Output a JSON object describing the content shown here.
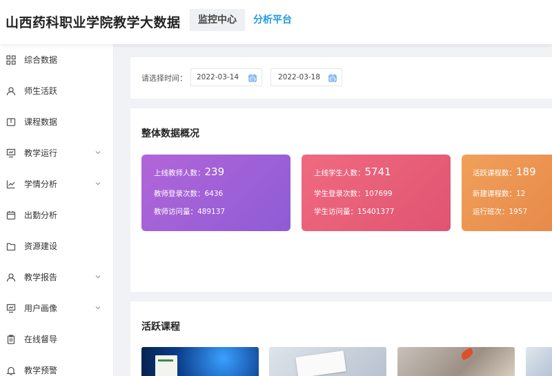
{
  "header": {
    "title": "山西药科职业学院教学大数据",
    "tabs": [
      {
        "label": "监控中心",
        "active": false
      },
      {
        "label": "分析平台",
        "active": true
      }
    ],
    "accent_color": "#1e9be0"
  },
  "sidebar": {
    "items": [
      {
        "label": "综合数据",
        "icon": "grid-icon",
        "expandable": false
      },
      {
        "label": "师生活跃",
        "icon": "user-icon",
        "expandable": false
      },
      {
        "label": "课程数据",
        "icon": "book-icon",
        "expandable": false
      },
      {
        "label": "教学运行",
        "icon": "monitor-icon",
        "expandable": true
      },
      {
        "label": "学情分析",
        "icon": "line-chart-icon",
        "expandable": true
      },
      {
        "label": "出勤分析",
        "icon": "calendar-icon",
        "expandable": false
      },
      {
        "label": "资源建设",
        "icon": "folder-icon",
        "expandable": false
      },
      {
        "label": "教学报告",
        "icon": "user-icon",
        "expandable": true
      },
      {
        "label": "用户画像",
        "icon": "monitor-icon",
        "expandable": true
      },
      {
        "label": "在线督导",
        "icon": "clipboard-icon",
        "expandable": false
      },
      {
        "label": "教学预警",
        "icon": "bell-icon",
        "expandable": false
      }
    ]
  },
  "date_filter": {
    "label": "请选择时间：",
    "start": "2022-03-14",
    "end": "2022-03-18",
    "separator": "-"
  },
  "overview": {
    "title": "整体数据概况",
    "cards": [
      {
        "color": "purple",
        "headline_label": "上线教师人数：",
        "headline_value": "239",
        "line2": "教师登录次数：6436",
        "line3": "教师访问量：489137"
      },
      {
        "color": "red",
        "headline_label": "上线学生人数：",
        "headline_value": "5741",
        "line2": "学生登录次数：107699",
        "line3": "学生访问量：15401377"
      },
      {
        "color": "orange",
        "headline_label": "活跃课程数：",
        "headline_value": "189",
        "line2": "新建课程数：12",
        "line3": "运行班次：1957"
      }
    ]
  },
  "courses": {
    "title": "活跃课程"
  }
}
